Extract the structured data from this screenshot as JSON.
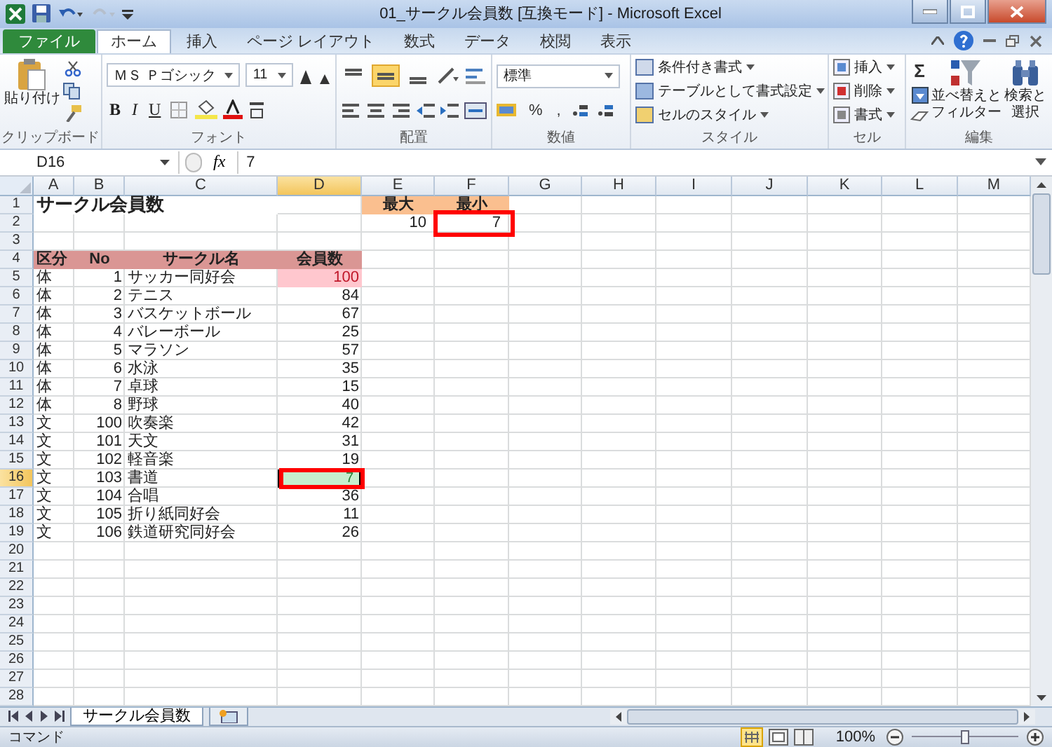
{
  "window": {
    "title": "01_サークル会員数 [互換モード] - Microsoft Excel"
  },
  "tabs": [
    {
      "label": "ファイル",
      "kind": "file",
      "selected": false
    },
    {
      "label": "ホーム",
      "kind": "tab",
      "selected": true
    },
    {
      "label": "挿入",
      "kind": "tab",
      "selected": false
    },
    {
      "label": "ページ レイアウト",
      "kind": "tab",
      "selected": false
    },
    {
      "label": "数式",
      "kind": "tab",
      "selected": false
    },
    {
      "label": "データ",
      "kind": "tab",
      "selected": false
    },
    {
      "label": "校閲",
      "kind": "tab",
      "selected": false
    },
    {
      "label": "表示",
      "kind": "tab",
      "selected": false
    }
  ],
  "ribbon": {
    "clipboard": {
      "paste": "貼り付け",
      "label": "クリップボード"
    },
    "font": {
      "name": "ＭＳ Ｐゴシック",
      "size": "11",
      "format_buttons": [
        "B",
        "I",
        "U"
      ],
      "label": "フォント"
    },
    "alignment": {
      "label": "配置"
    },
    "number": {
      "format": "標準",
      "symbols": [
        "%",
        ","
      ],
      "label": "数値"
    },
    "styles": {
      "items": [
        "条件付き書式",
        "テーブルとして書式設定",
        "セルのスタイル"
      ],
      "label": "スタイル"
    },
    "cells": {
      "items": [
        "挿入",
        "削除",
        "書式"
      ],
      "label": "セル"
    },
    "editing": {
      "sum": "Σ",
      "sort": [
        "並べ替えと",
        "フィルター"
      ],
      "find": [
        "検索と",
        "選択"
      ],
      "label": "編集"
    }
  },
  "formula_bar": {
    "name_box": "D16",
    "function_label": "fx",
    "value": "7"
  },
  "sheet": {
    "columns": [
      "A",
      "B",
      "C",
      "D",
      "E",
      "F",
      "G",
      "H",
      "I",
      "J",
      "K",
      "L",
      "M"
    ],
    "rows": [
      "1",
      "2",
      "3",
      "4",
      "5",
      "6",
      "7",
      "8",
      "9",
      "10",
      "11",
      "12",
      "13",
      "14",
      "15",
      "16",
      "17",
      "18",
      "19",
      "20",
      "21",
      "22",
      "23",
      "24",
      "25",
      "26",
      "27",
      "28"
    ],
    "title": "サークル会員数",
    "summary": [
      {
        "label": "最大",
        "value": "10",
        "boxed": false
      },
      {
        "label": "最小",
        "value": "7",
        "boxed": true
      }
    ],
    "table": {
      "columns": [
        "区分",
        "No",
        "サークル名",
        "会員数"
      ],
      "rows": [
        {
          "category": "体",
          "no": "1",
          "name": "サッカー同好会",
          "members": "100",
          "max": true,
          "min": false,
          "selected": false,
          "boxed": false
        },
        {
          "category": "体",
          "no": "2",
          "name": "テニス",
          "members": "84",
          "max": false,
          "min": false,
          "selected": false,
          "boxed": false
        },
        {
          "category": "体",
          "no": "3",
          "name": "バスケットボール",
          "members": "67",
          "max": false,
          "min": false,
          "selected": false,
          "boxed": false
        },
        {
          "category": "体",
          "no": "4",
          "name": "バレーボール",
          "members": "25",
          "max": false,
          "min": false,
          "selected": false,
          "boxed": false
        },
        {
          "category": "体",
          "no": "5",
          "name": "マラソン",
          "members": "57",
          "max": false,
          "min": false,
          "selected": false,
          "boxed": false
        },
        {
          "category": "体",
          "no": "6",
          "name": "水泳",
          "members": "35",
          "max": false,
          "min": false,
          "selected": false,
          "boxed": false
        },
        {
          "category": "体",
          "no": "7",
          "name": "卓球",
          "members": "15",
          "max": false,
          "min": false,
          "selected": false,
          "boxed": false
        },
        {
          "category": "体",
          "no": "8",
          "name": "野球",
          "members": "40",
          "max": false,
          "min": false,
          "selected": false,
          "boxed": false
        },
        {
          "category": "文",
          "no": "100",
          "name": "吹奏楽",
          "members": "42",
          "max": false,
          "min": false,
          "selected": false,
          "boxed": false
        },
        {
          "category": "文",
          "no": "101",
          "name": "天文",
          "members": "31",
          "max": false,
          "min": false,
          "selected": false,
          "boxed": false
        },
        {
          "category": "文",
          "no": "102",
          "name": "軽音楽",
          "members": "19",
          "max": false,
          "min": false,
          "selected": false,
          "boxed": false
        },
        {
          "category": "文",
          "no": "103",
          "name": "書道",
          "members": "7",
          "max": false,
          "min": true,
          "selected": true,
          "boxed": true
        },
        {
          "category": "文",
          "no": "104",
          "name": "合唱",
          "members": "36",
          "max": false,
          "min": false,
          "selected": false,
          "boxed": false
        },
        {
          "category": "文",
          "no": "105",
          "name": "折り紙同好会",
          "members": "11",
          "max": false,
          "min": false,
          "selected": false,
          "boxed": false
        },
        {
          "category": "文",
          "no": "106",
          "name": "鉄道研究同好会",
          "members": "26",
          "max": false,
          "min": false,
          "selected": false,
          "boxed": false
        }
      ]
    }
  },
  "sheet_tabs": [
    {
      "label": "サークル会員数",
      "selected": true
    }
  ],
  "status_bar": {
    "mode": "コマンド",
    "zoom": "100%",
    "level": 0.5
  }
}
